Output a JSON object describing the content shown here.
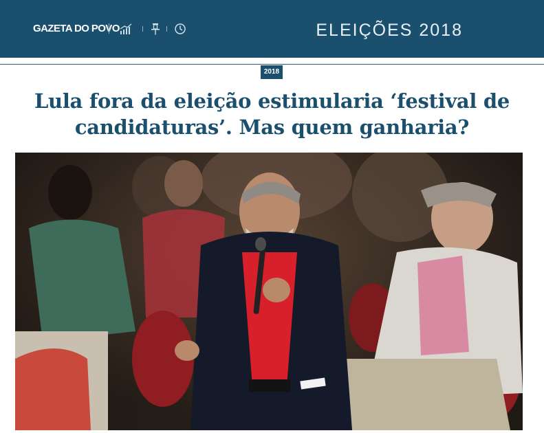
{
  "header": {
    "logo": "GAZETA DO POVO",
    "section_title": "ELEIÇÕES 2018",
    "icons": [
      "chart-icon",
      "pin-icon",
      "clock-icon"
    ],
    "background_color": "#1b4f6e"
  },
  "article": {
    "badge": "2018",
    "headline": "Lula fora da eleição estimularia ‘festival de candidaturas’. Mas quem ganharia?",
    "headline_color": "#1b4f6e"
  }
}
